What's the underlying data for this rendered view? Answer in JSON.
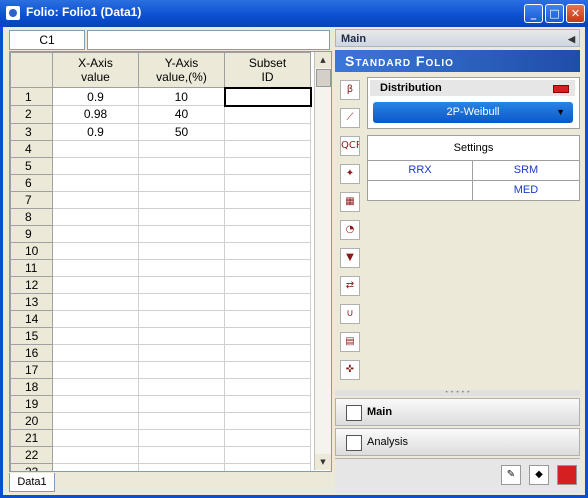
{
  "window": {
    "title": "Folio: Folio1 (Data1)"
  },
  "formula_bar": {
    "cell_ref": "C1",
    "value": ""
  },
  "grid": {
    "headers": [
      {
        "line1": "X-Axis",
        "line2": "value"
      },
      {
        "line1": "Y-Axis",
        "line2": "value,(%)"
      },
      {
        "line1": "Subset",
        "line2": "ID"
      }
    ],
    "rows": [
      {
        "n": "1",
        "x": "0.9",
        "y": "10",
        "s": ""
      },
      {
        "n": "2",
        "x": "0.98",
        "y": "40",
        "s": ""
      },
      {
        "n": "3",
        "x": "0.9",
        "y": "50",
        "s": ""
      },
      {
        "n": "4",
        "x": "",
        "y": "",
        "s": ""
      },
      {
        "n": "5",
        "x": "",
        "y": "",
        "s": ""
      },
      {
        "n": "6",
        "x": "",
        "y": "",
        "s": ""
      },
      {
        "n": "7",
        "x": "",
        "y": "",
        "s": ""
      },
      {
        "n": "8",
        "x": "",
        "y": "",
        "s": ""
      },
      {
        "n": "9",
        "x": "",
        "y": "",
        "s": ""
      },
      {
        "n": "10",
        "x": "",
        "y": "",
        "s": ""
      },
      {
        "n": "11",
        "x": "",
        "y": "",
        "s": ""
      },
      {
        "n": "12",
        "x": "",
        "y": "",
        "s": ""
      },
      {
        "n": "13",
        "x": "",
        "y": "",
        "s": ""
      },
      {
        "n": "14",
        "x": "",
        "y": "",
        "s": ""
      },
      {
        "n": "15",
        "x": "",
        "y": "",
        "s": ""
      },
      {
        "n": "16",
        "x": "",
        "y": "",
        "s": ""
      },
      {
        "n": "17",
        "x": "",
        "y": "",
        "s": ""
      },
      {
        "n": "18",
        "x": "",
        "y": "",
        "s": ""
      },
      {
        "n": "19",
        "x": "",
        "y": "",
        "s": ""
      },
      {
        "n": "20",
        "x": "",
        "y": "",
        "s": ""
      },
      {
        "n": "21",
        "x": "",
        "y": "",
        "s": ""
      },
      {
        "n": "22",
        "x": "",
        "y": "",
        "s": ""
      },
      {
        "n": "23",
        "x": "",
        "y": "",
        "s": ""
      }
    ]
  },
  "sheet_tab": "Data1",
  "panel": {
    "header": "Main",
    "banner": "Standard Folio",
    "distribution_label": "Distribution",
    "distribution_value": "2P-Weibull",
    "settings_title": "Settings",
    "settings": {
      "rrx": "RRX",
      "srm": "SRM",
      "med": "MED"
    },
    "nav_main": "Main",
    "nav_analysis": "Analysis"
  }
}
